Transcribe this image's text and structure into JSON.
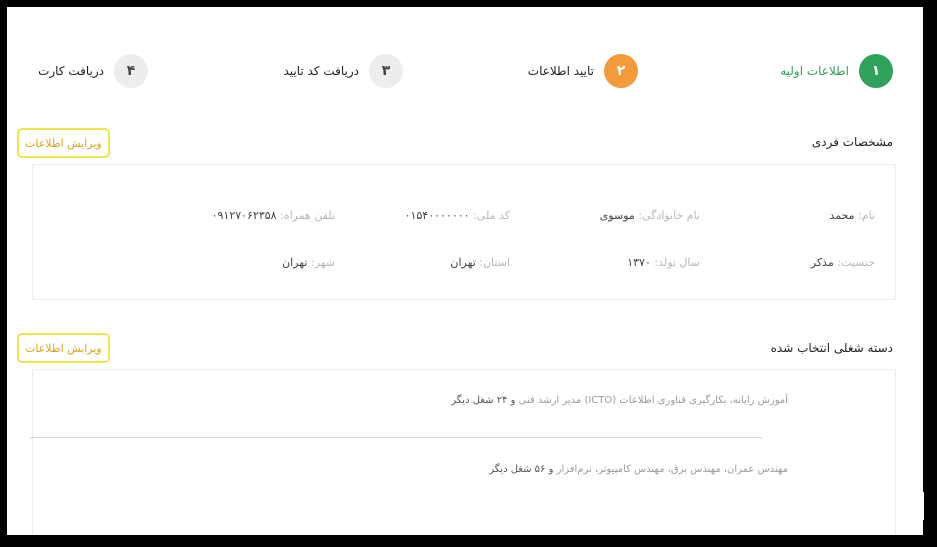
{
  "steps": [
    {
      "number": "۱",
      "label": "اطلاعات اولیه",
      "state": "done",
      "color": "#2fa15a"
    },
    {
      "number": "۲",
      "label": "تایید اطلاعات",
      "state": "active",
      "color": "#f39a3a"
    },
    {
      "number": "۳",
      "label": "دریافت کد تایید",
      "state": "pending",
      "color": "#ededed"
    },
    {
      "number": "۴",
      "label": "دریافت کارت",
      "state": "pending",
      "color": "#ededed"
    }
  ],
  "personal": {
    "title": "مشخصات فردی",
    "edit_label": "ویرایش اطلاعات",
    "fields": {
      "first_name": {
        "label": "نام:",
        "value": "محمد"
      },
      "last_name": {
        "label": "نام خانوادگی:",
        "value": "موسوی"
      },
      "national_code": {
        "label": "کد ملی:",
        "value": "۰۱۵۴۰۰۰۰۰۰۰"
      },
      "mobile": {
        "label": "تلفن همراه:",
        "value": "۰۹۱۲۷۰۶۲۳۵۸"
      },
      "gender": {
        "label": "جنسیت:",
        "value": "مذکر"
      },
      "birth_year": {
        "label": "سال تولد:",
        "value": "۱۳۷۰"
      },
      "province": {
        "label": "استان:",
        "value": "تهران"
      },
      "city": {
        "label": "شهر:",
        "value": "تهران"
      }
    }
  },
  "jobs": {
    "title": "دسته شغلی انتخاب شده",
    "edit_label": "ویرایش اطلاعات",
    "items": [
      {
        "text": "آموزش رایانه، بکارگیری فناوری اطلاعات (ICTO) مدیر ارشد فنی",
        "more": "و ۲۴ شغل دیگر"
      },
      {
        "text": "مهندس عمران، مهندس برق، مهندس کامپیوتر، نرم‌افزار",
        "more": "و ۵۶ شغل دیگر"
      }
    ]
  }
}
